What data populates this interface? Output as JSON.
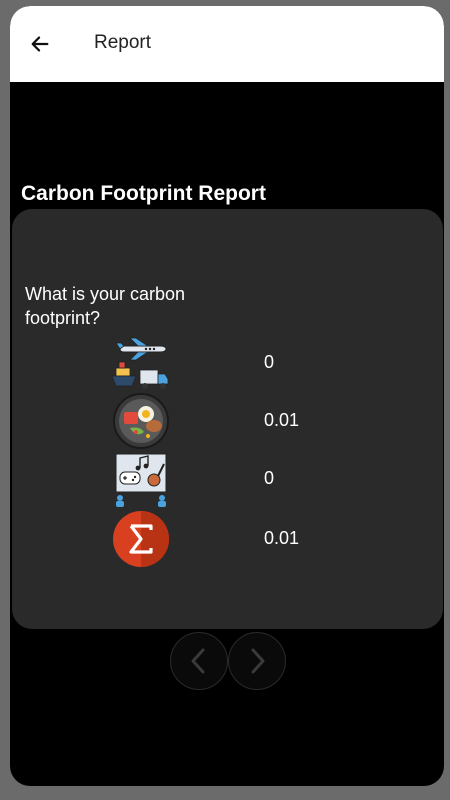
{
  "appbar": {
    "title": "Report",
    "back_icon": "arrow-left-icon"
  },
  "report": {
    "heading": "Carbon Footprint Report",
    "question": "What is your carbon footprint?",
    "rows": [
      {
        "icon": "transport-icon",
        "value": "0"
      },
      {
        "icon": "food-icon",
        "value": "0.01"
      },
      {
        "icon": "entertainment-icon",
        "value": "0"
      },
      {
        "icon": "sum-icon",
        "value": "0.01"
      }
    ]
  },
  "navigation": {
    "prev_icon": "chevron-left-icon",
    "next_icon": "chevron-right-icon"
  },
  "colors": {
    "background": "#000000",
    "card": "#2a2a2a",
    "appbar": "#ffffff",
    "sum_badge": "#d9401f"
  }
}
